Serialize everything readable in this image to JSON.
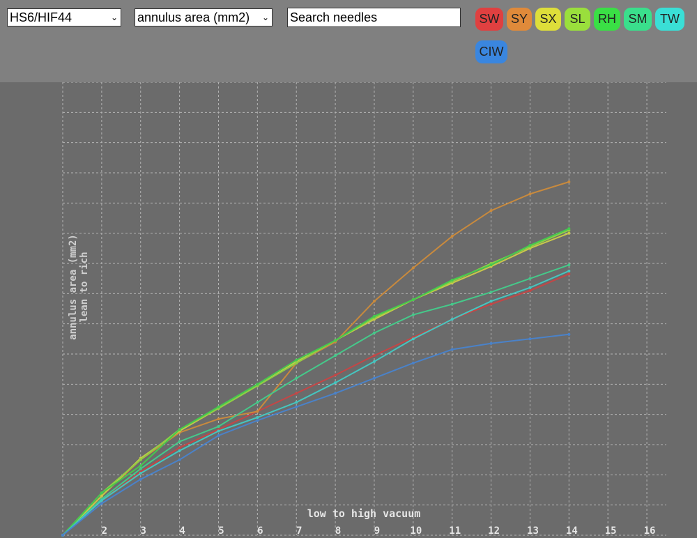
{
  "toolbar": {
    "needle_select_value": "HS6/HIF44",
    "metric_select_value": "annulus area (mm2)",
    "search_value": "Search needles",
    "pills": [
      {
        "label": "SW",
        "color": "#e04040"
      },
      {
        "label": "SY",
        "color": "#e08a3a"
      },
      {
        "label": "SX",
        "color": "#dede3a"
      },
      {
        "label": "SL",
        "color": "#9adf3c"
      },
      {
        "label": "RH",
        "color": "#3adf45"
      },
      {
        "label": "SM",
        "color": "#3adf8c"
      },
      {
        "label": "TW",
        "color": "#3adfd6"
      },
      {
        "label": "CIW",
        "color": "#3a86df"
      }
    ]
  },
  "chart_data": {
    "type": "line",
    "xlabel": "low to high vacuum",
    "ylabel_lines": [
      "annulus area (mm2)",
      "lean to rich"
    ],
    "x_ticks": [
      2,
      3,
      4,
      5,
      6,
      7,
      8,
      9,
      10,
      11,
      12,
      13,
      14,
      15,
      16
    ],
    "xlim": [
      1,
      16.5
    ],
    "ylim": [
      0,
      15
    ],
    "grid": true,
    "x": [
      1,
      2,
      3,
      4,
      5,
      6,
      7,
      8,
      9,
      10,
      11,
      12,
      13,
      14
    ],
    "series": [
      {
        "name": "SW",
        "color": "#c44646",
        "values": [
          0,
          1.15,
          2.1,
          2.9,
          3.5,
          4.1,
          4.7,
          5.3,
          5.95,
          6.55,
          7.15,
          7.65,
          8.1,
          8.65
        ]
      },
      {
        "name": "SY",
        "color": "#c98a3d",
        "values": [
          0,
          1.3,
          2.5,
          3.4,
          3.85,
          4.1,
          5.7,
          6.4,
          7.75,
          8.85,
          9.9,
          10.75,
          11.3,
          11.7
        ]
      },
      {
        "name": "SX",
        "color": "#c9c94a",
        "values": [
          0,
          1.3,
          2.55,
          3.45,
          4.2,
          4.95,
          5.75,
          6.45,
          7.15,
          7.8,
          8.35,
          8.9,
          9.5,
          10.0
        ]
      },
      {
        "name": "SL",
        "color": "#8fcf45",
        "values": [
          0,
          1.4,
          2.5,
          3.5,
          4.2,
          4.95,
          5.7,
          6.45,
          7.2,
          7.8,
          8.4,
          9.0,
          9.55,
          10.1
        ]
      },
      {
        "name": "RH",
        "color": "#45c94f",
        "values": [
          0,
          1.4,
          2.3,
          3.5,
          4.25,
          5.0,
          5.8,
          6.45,
          7.25,
          7.8,
          8.45,
          8.95,
          9.6,
          10.15
        ]
      },
      {
        "name": "SM",
        "color": "#45c98a",
        "values": [
          0,
          1.2,
          2.2,
          3.1,
          3.6,
          4.4,
          5.2,
          5.95,
          6.7,
          7.3,
          7.65,
          8.05,
          8.5,
          8.95
        ]
      },
      {
        "name": "TW",
        "color": "#45c6c0",
        "values": [
          0,
          1.15,
          2.05,
          2.8,
          3.45,
          3.9,
          4.4,
          5.05,
          5.75,
          6.5,
          7.15,
          7.75,
          8.2,
          8.75
        ]
      },
      {
        "name": "CIW",
        "color": "#4a82c9",
        "values": [
          0,
          1.05,
          1.85,
          2.5,
          3.3,
          3.8,
          4.25,
          4.7,
          5.2,
          5.7,
          6.15,
          6.35,
          6.5,
          6.65
        ]
      }
    ]
  }
}
